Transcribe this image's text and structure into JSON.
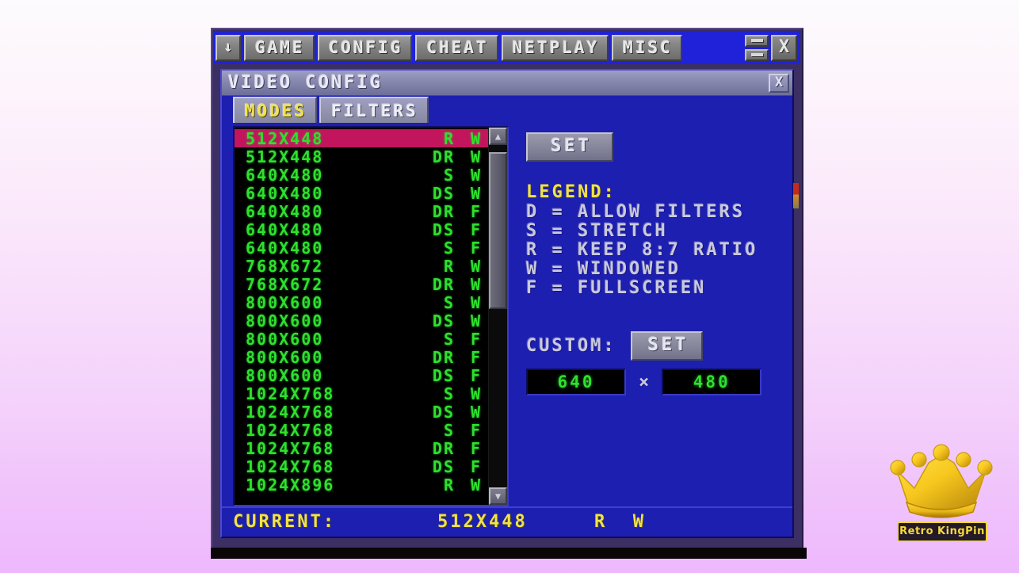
{
  "menubar": {
    "dropdown_icon": "down-arrow-icon",
    "items": [
      {
        "label": "GAME"
      },
      {
        "label": "CONFIG"
      },
      {
        "label": "CHEAT"
      },
      {
        "label": "NETPLAY"
      },
      {
        "label": "MISC"
      }
    ],
    "window_controls": {
      "restore_icon": "restore-bar-icon",
      "minimize_icon": "minimize-bar-icon",
      "close_label": "X"
    }
  },
  "dialog": {
    "title": "VIDEO CONFIG",
    "close_label": "X",
    "tabs": [
      {
        "label": "MODES",
        "active": true
      },
      {
        "label": "FILTERS",
        "active": false
      }
    ]
  },
  "mode_list": {
    "columns": [
      "resolution",
      "scale_flags",
      "screen_flag"
    ],
    "selected_index": 0,
    "rows": [
      {
        "resolution": "512X448",
        "flagA": "R",
        "flagB": "W"
      },
      {
        "resolution": "512X448",
        "flagA": "DR",
        "flagB": "W"
      },
      {
        "resolution": "640X480",
        "flagA": "S",
        "flagB": "W"
      },
      {
        "resolution": "640X480",
        "flagA": "DS",
        "flagB": "W"
      },
      {
        "resolution": "640X480",
        "flagA": "DR",
        "flagB": "F"
      },
      {
        "resolution": "640X480",
        "flagA": "DS",
        "flagB": "F"
      },
      {
        "resolution": "640X480",
        "flagA": "S",
        "flagB": "F"
      },
      {
        "resolution": "768X672",
        "flagA": "R",
        "flagB": "W"
      },
      {
        "resolution": "768X672",
        "flagA": "DR",
        "flagB": "W"
      },
      {
        "resolution": "800X600",
        "flagA": "S",
        "flagB": "W"
      },
      {
        "resolution": "800X600",
        "flagA": "DS",
        "flagB": "W"
      },
      {
        "resolution": "800X600",
        "flagA": "S",
        "flagB": "F"
      },
      {
        "resolution": "800X600",
        "flagA": "DR",
        "flagB": "F"
      },
      {
        "resolution": "800X600",
        "flagA": "DS",
        "flagB": "F"
      },
      {
        "resolution": "1024X768",
        "flagA": "S",
        "flagB": "W"
      },
      {
        "resolution": "1024X768",
        "flagA": "DS",
        "flagB": "W"
      },
      {
        "resolution": "1024X768",
        "flagA": "S",
        "flagB": "F"
      },
      {
        "resolution": "1024X768",
        "flagA": "DR",
        "flagB": "F"
      },
      {
        "resolution": "1024X768",
        "flagA": "DS",
        "flagB": "F"
      },
      {
        "resolution": "1024X896",
        "flagA": "R",
        "flagB": "W"
      }
    ],
    "scrollbar": {
      "up_arrow": "▲",
      "down_arrow": "▼"
    }
  },
  "right_panel": {
    "set_button": "SET",
    "legend": {
      "title": "LEGEND:",
      "entries": [
        "D = ALLOW FILTERS",
        "S = STRETCH",
        "R = KEEP 8:7 RATIO",
        "W = WINDOWED",
        "F = FULLSCREEN"
      ]
    },
    "custom": {
      "label": "CUSTOM:",
      "set_button": "SET",
      "width_value": "640",
      "height_value": "480",
      "separator": "×"
    }
  },
  "statusbar": {
    "label": "CURRENT:",
    "resolution": "512X448",
    "flags": "R  W"
  },
  "logo": {
    "text": "Retro KingPin",
    "icon": "crown-icon"
  },
  "colors": {
    "menubar_blue": "#1f22d8",
    "dialog_blue": "#1d1fb0",
    "list_green": "#2ee02e",
    "selection_crimson": "#c2155e",
    "accent_yellow": "#f0e24a",
    "button_gray": "#85859a",
    "logo_gold": "#f6d93c"
  }
}
